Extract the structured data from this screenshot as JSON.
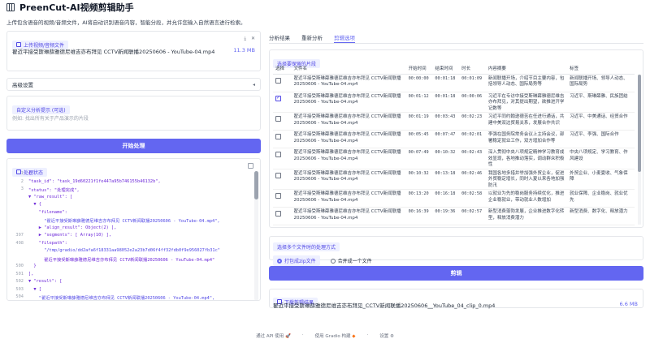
{
  "app": {
    "title": "PreenCut-AI视频剪辑助手",
    "subtitle": "上传包含语音的视频/音频文件，AI将自动识别语音内容，智能分段，并允许您输入自然语言进行检索。"
  },
  "upload": {
    "label": "上传视频/音频文件",
    "file_name": "翟近平接受斯琳薛雅德尼维吉亦布拜见 CCTV新闻联播20250606 - YouTube-04.mp4",
    "file_size": "11.3 MB",
    "download_icon": "download-icon",
    "close_icon": "close-icon"
  },
  "advanced": {
    "label": "高级设置"
  },
  "prompt": {
    "label": "自定义分析提示 (可选)",
    "placeholder": "例如: 找出所有关于产品演示的片段"
  },
  "start_button": "开始处理",
  "status": {
    "label": "处理状态",
    "lines": [
      {
        "n": "1",
        "t": "{"
      },
      {
        "n": "2",
        "t": "\"task_id\": \"task_19d60221f1fe447a95b746155b46132b\","
      },
      {
        "n": "3",
        "t": "\"status\": \"处理完成\","
      },
      {
        "n": "",
        "t": "▼ \"raw_result\": ["
      },
      {
        "n": "",
        "t": "  ▼ {"
      },
      {
        "n": "",
        "t": "    \"filename\":"
      },
      {
        "n": "",
        "t": "      \"翟近平接受斯琳薛雅德尼维吉亦布拜见 CCTV新闻联播20250606 - YouTube-04.mp4\","
      },
      {
        "n": "",
        "t": "    ▶ \"align_result\": Object(2) ],"
      },
      {
        "n": "397",
        "t": "    ▶ \"segments\": [ Array(10) ],"
      },
      {
        "n": "498",
        "t": "    \"filepath\":"
      },
      {
        "n": "",
        "t": "      \"/tmp/gradio/dd2afa6f18331aa98052e2a23b7d06f4ff32fdb0f9e956027fb31c\""
      },
      {
        "n": "",
        "t": "      翟近平接受斯琳薛雅德尼维吉亦布拜见 CCTV新闻联播20250606 - YouTube-04.mp4\""
      },
      {
        "n": "500",
        "t": "  }"
      },
      {
        "n": "501",
        "t": "],"
      },
      {
        "n": "502",
        "t": "▼ \"result\": ["
      },
      {
        "n": "503",
        "t": "  ▼ ["
      },
      {
        "n": "504",
        "t": "    \"翟近平接受斯琳薛雅德尼维吉亦布拜见 CCTV新闻联播20250606 - YouTube-04.mp4\","
      },
      {
        "n": "",
        "t": ""
      },
      {
        "n": "505",
        "t": "    \"00:00:00\","
      },
      {
        "n": "506",
        "t": "    \"00:01:18\","
      },
      {
        "n": "507",
        "t": "    \"00:01:09\","
      }
    ]
  },
  "tabs": [
    "分析结果",
    "重新分析",
    "剪辑选项"
  ],
  "active_tab": "剪辑选项",
  "segments": {
    "label": "选择要保留的片段",
    "headers": [
      "选择",
      "文件名",
      "开始时间",
      "结束时间",
      "时长",
      "内容摘要",
      "标签"
    ],
    "rows": [
      {
        "checked": false,
        "file": "翟近平接受斯琳薛雅德尼维吉亦布拜见 CCTV新闻联播20250606 - YouTube-04.mp4",
        "start": "00:00:00",
        "end": "00:01:18",
        "dur": "00:01:09",
        "summary": "新闻联播开场，介绍节目主要内容，包括领导人动态、国际局势等",
        "tags": "新闻联播开场、领导人动态、国际局势"
      },
      {
        "checked": true,
        "file": "翟近平接受斯琳薛雅德尼维吉亦布拜见 CCTV新闻联播20250606 - YouTube-04.mp4",
        "start": "00:01:12",
        "end": "00:01:18",
        "dur": "00:00:06",
        "summary": "习近平在专访中接受斯琳薛雅德尼维吉亦布拜见，对其提出期望，欲推进开学记数等",
        "tags": "习近平、斯琳薛雅、民族团结"
      },
      {
        "checked": false,
        "file": "翟近平接受斯琳薛雅德尼维吉亦布拜见 CCTV新闻联播20250606 - YouTube-04.mp4",
        "start": "00:01:19",
        "end": "00:03:43",
        "dur": "00:02:23",
        "summary": "习近平同约翰逊德苦在任进行通话，共建中美双边贸易关系，发展合作共识",
        "tags": "习近平、中美通话、经贸合作"
      },
      {
        "checked": false,
        "file": "翟近平接受斯琳薛雅德尼维吉亦布拜见 CCTV新闻联播20250606 - YouTube-04.mp4",
        "start": "00:05:45",
        "end": "00:07:47",
        "dur": "00:02:01",
        "summary": "李强在国务院常务会议上主持会议，部署稳定就业工作，双方增加合作等",
        "tags": "习近平、李强、国际合作"
      },
      {
        "checked": false,
        "file": "翟近平接受斯琳薛雅德尼维吉亦布拜见 CCTV新闻联播20250606 - YouTube-04.mp4",
        "start": "00:07:49",
        "end": "00:10:32",
        "dur": "00:02:43",
        "summary": "深入贯彻中央八项规定精神学习教育成效显现，各地推动落实，调动群众积极性",
        "tags": "中央八项规定、学习教育、作风建设"
      },
      {
        "checked": false,
        "file": "翟近平接受斯琳薛雅德尼维吉亦布拜见 CCTV新闻联播20250606 - YouTube-04.mp4",
        "start": "00:10:32",
        "end": "00:13:18",
        "dur": "00:02:46",
        "summary": "我国各地多措并举加强外贸企业，促进外贸稳定增长，同时入夏以来各地加强防汛",
        "tags": "外贸企业、小麦夏收、气象保障"
      },
      {
        "checked": false,
        "file": "翟近平接受斯琳薛雅德尼维吉亦布拜见 CCTV新闻联播20250606 - YouTube-04.mp4",
        "start": "00:13:20",
        "end": "00:16:18",
        "dur": "00:02:58",
        "summary": "以就业为先的稳岗服务持续优化，推进企业稳就业，带动就业人数增加",
        "tags": "就业保障、企业稳岗、就业优先"
      },
      {
        "checked": false,
        "file": "翟近平接受斯琳薛雅德尼维吉亦布拜见 CCTV新闻联播20250606 - YouTube-04.mp4",
        "start": "00:16:39",
        "end": "00:19:36",
        "dur": "00:02:57",
        "summary": "新型消费蓬勃发展，企业推进数字化转型，释放消费潜力",
        "tags": "新型消费、数字化、释放潜力"
      }
    ]
  },
  "method": {
    "label": "选择多个文件时的处理方式",
    "options": [
      "打包成zip文件",
      "合并成一个文件"
    ],
    "selected": 0
  },
  "cut_button": "剪辑",
  "download": {
    "label": "下载剪辑结果",
    "file_name": "翟近平接受斯琳薛雅德尼维吉亦布拜见_CCTV新闻联播20250606__YouTube_04_clip_0.mp4",
    "file_size": "6.6 MB"
  },
  "footer": {
    "api": "通过 API 使用",
    "built": "使用 Gradio 构建",
    "settings": "设置"
  },
  "colors": {
    "accent": "#6366f1"
  }
}
